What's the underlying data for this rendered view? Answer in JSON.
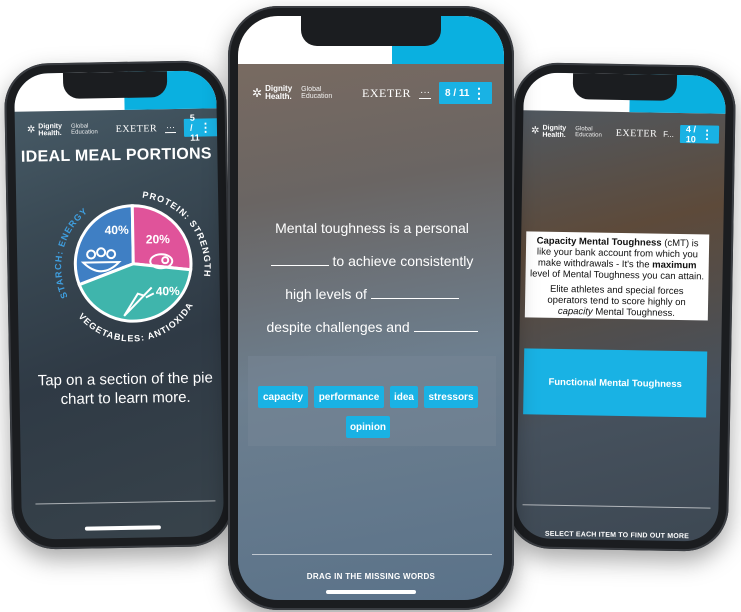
{
  "brand": {
    "logo_line1": "Dignity",
    "logo_line2": "Health.",
    "division": "Global Education",
    "partner": "EXETER",
    "more": "···"
  },
  "colors": {
    "accent": "#19b2e4",
    "white": "#ffffff",
    "pie_blue": "#3f7fc4",
    "pie_pink": "#e0539a",
    "pie_teal": "#3fb5ac"
  },
  "left_screen": {
    "counter": "5 / 11",
    "partner_short": "EXETER",
    "title": "IDEAL MEAL PORTIONS",
    "pie": {
      "segments": [
        {
          "name": "STARCH: ENERGY",
          "percent": "40%",
          "color": "#3f7fc4",
          "icon": "noodle-bowl-icon"
        },
        {
          "name": "PROTEIN: STRENGTH",
          "percent": "20%",
          "color": "#e0539a",
          "icon": "steak-icon"
        },
        {
          "name": "VEGETABLES: ANTIOXIDANTS",
          "percent": "40%",
          "color": "#3fb5ac",
          "icon": "carrot-icon"
        }
      ]
    },
    "instruction": "Tap on a section of the pie chart to learn more."
  },
  "middle_screen": {
    "counter": "8 / 11",
    "sentence": {
      "part1": "Mental toughness is a personal",
      "part2": "to achieve consistently",
      "part3": "high levels of",
      "part4": "despite challenges and"
    },
    "options": [
      "capacity",
      "performance",
      "idea",
      "stressors",
      "opinion"
    ],
    "footer": "DRAG IN THE MISSING WORDS"
  },
  "right_screen": {
    "counter": "4 / 10",
    "partner_short": "EXETER",
    "partner_extra": "F...",
    "info": {
      "term": "Capacity Mental Toughness",
      "abbr": "(cMT) is like your bank account from which you make withdrawals - It's the",
      "emphasis": "maximum",
      "rest": "level of Mental Toughness you can attain.",
      "para2_a": "Elite athletes and special forces operators tend to score highly on",
      "para2_em": "capacity",
      "para2_b": "Mental Toughness."
    },
    "button": "Functional Mental Toughness",
    "footer": "SELECT EACH ITEM TO FIND OUT MORE"
  }
}
